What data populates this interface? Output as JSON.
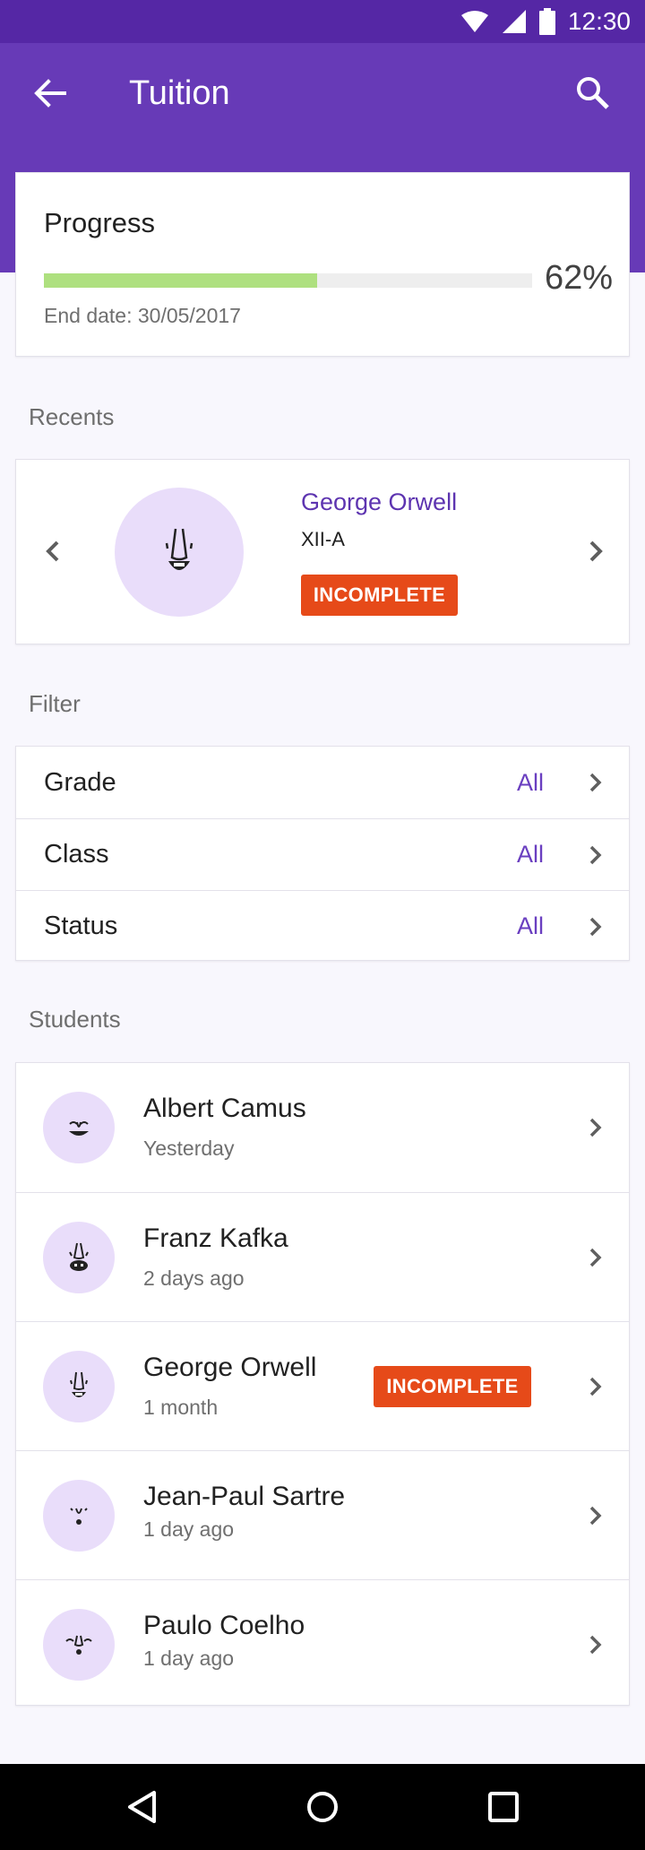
{
  "status_bar": {
    "time": "12:30"
  },
  "app_bar": {
    "title": "Tuition"
  },
  "progress": {
    "label": "Progress",
    "percent_text": "62%",
    "fraction": 0.56,
    "end_date": "End date: 30/05/2017"
  },
  "recents": {
    "section_title": "Recents",
    "name": "George Orwell",
    "grade": "XII-A",
    "badge": "INCOMPLETE"
  },
  "filter": {
    "section_title": "Filter",
    "rows": [
      {
        "label": "Grade",
        "value": "All"
      },
      {
        "label": "Class",
        "value": "All"
      },
      {
        "label": "Status",
        "value": "All"
      }
    ]
  },
  "students": {
    "section_title": "Students",
    "rows": [
      {
        "name": "Albert Camus",
        "when": "Yesterday"
      },
      {
        "name": "Franz Kafka",
        "when": "2 days ago"
      },
      {
        "name": "George Orwell",
        "when": "1 month",
        "badge": "INCOMPLETE"
      },
      {
        "name": "Jean-Paul Sartre",
        "when": "1 day ago"
      },
      {
        "name": "Paulo Coelho",
        "when": "1 day ago"
      }
    ]
  },
  "colors": {
    "primary": "#673ab7",
    "primary_dark": "#5527a5",
    "accent_text": "#5d34b0",
    "badge": "#e64a19",
    "progress_fill": "#aee07f",
    "avatar_bg": "#e9ddfa"
  },
  "icons": {
    "status": [
      "wifi-icon",
      "signal-icon",
      "battery-icon"
    ],
    "app_bar": [
      "back-arrow-icon",
      "search-icon"
    ],
    "nav": [
      "back-triangle-icon",
      "home-circle-icon",
      "recents-square-icon"
    ]
  }
}
